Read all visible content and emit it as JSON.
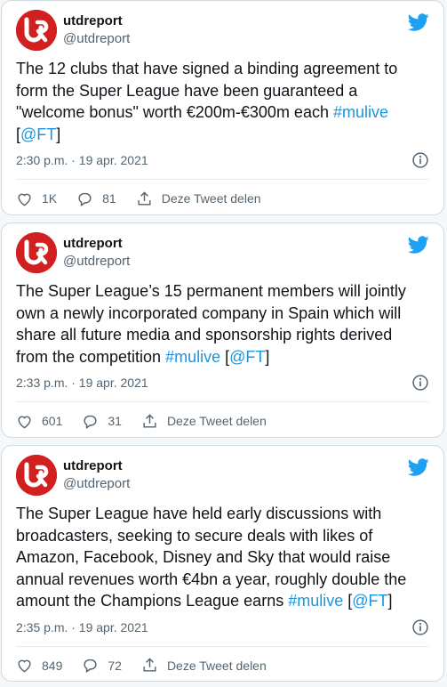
{
  "colors": {
    "brand_red": "#d21f1f",
    "link": "#1b95e0",
    "twitter_blue": "#1da1f2"
  },
  "icons": [
    "utd-logo-avatar",
    "twitter-bird-icon",
    "info-icon",
    "heart-icon",
    "reply-icon",
    "share-icon"
  ],
  "tweets": [
    {
      "name": "utdreport",
      "handle": "@utdreport",
      "text": "The 12 clubs that have signed a binding agreement to form the Super League have been guaranteed a \"welcome bonus\" worth €200m-€300m each ",
      "hashtag": "#mulive",
      "bracket_open": "[",
      "mention": "@FT",
      "bracket_close": "]",
      "time": "2:30 p.m. · 19 apr. 2021",
      "likes": "1K",
      "replies": "81",
      "share_label": "Deze Tweet delen"
    },
    {
      "name": "utdreport",
      "handle": "@utdreport",
      "text": "The Super League’s 15 permanent members will jointly own a newly incorporated company in Spain which will share all future media and sponsorship rights derived from the competition ",
      "hashtag": "#mulive",
      "bracket_open": " [",
      "mention": "@FT",
      "bracket_close": "]",
      "time": "2:33 p.m. · 19 apr. 2021",
      "likes": "601",
      "replies": "31",
      "share_label": "Deze Tweet delen"
    },
    {
      "name": "utdreport",
      "handle": "@utdreport",
      "text": "The Super League have held early discussions with broadcasters, seeking to secure deals with likes of Amazon, Facebook, Disney and Sky that would raise annual revenues worth €4bn a year, roughly double the amount the Champions League earns ",
      "hashtag": "#mulive",
      "bracket_open": " [",
      "mention": "@FT",
      "bracket_close": "]",
      "time": "2:35 p.m. · 19 apr. 2021",
      "likes": "849",
      "replies": "72",
      "share_label": "Deze Tweet delen"
    }
  ]
}
